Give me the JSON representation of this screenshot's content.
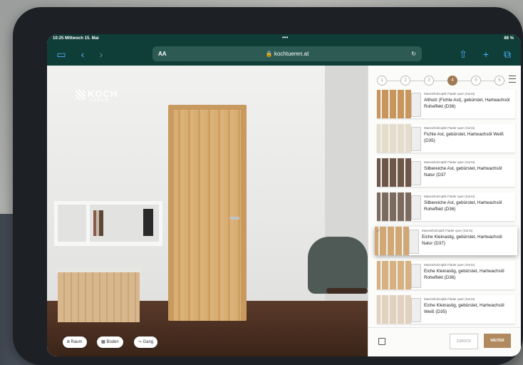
{
  "status": {
    "time": "10:25 Mittwoch 15. Mai",
    "battery": "88 %"
  },
  "browser": {
    "aa": "AA",
    "url": "kochtueren.at"
  },
  "logo": {
    "name": "KOCH",
    "sub": "TÜREN"
  },
  "room_buttons": [
    "Raum",
    "Boden",
    "Gang"
  ],
  "steps": [
    "1",
    "2",
    "3",
    "4",
    "5",
    "6"
  ],
  "active_step": 4,
  "options": [
    {
      "category": "Massivholzoptik Flader quer (Sorra)",
      "title": "Altholz (Fichte Ast), gebürstet, Hartwachsöl Roheffekt (D36)",
      "color": "#c8955a"
    },
    {
      "category": "Massivholzoptik Flader quer (Sorra)",
      "title": "Fichte Ast, gebürstet, Hartwachsöl Weiß (D35)",
      "color": "#e6dccb"
    },
    {
      "category": "Massivholzoptik Flader quer (Sorra)",
      "title": "Silbereiche Ast, gebürstet, Hartwachsöl Natur (D37",
      "color": "#6e5648"
    },
    {
      "category": "Massivholzoptik Flader quer (Sorra)",
      "title": "Silbereiche Ast, gebürstet, Hartwachsöl Roheffekt (D36)",
      "color": "#7d6a5f"
    },
    {
      "category": "Massivholzoptik Flader quer (Sorra)",
      "title": "Eiche Kleinastig, gebürstet, Hartwachsöl Natur (D37)",
      "color": "#d1a774",
      "selected": true
    },
    {
      "category": "Massivholzoptik Flader quer (Sorra)",
      "title": "Eiche Kleinastig, gebürstet, Hartwachsöl Roheffekt (D36)",
      "color": "#d7b17f"
    },
    {
      "category": "Massivholzoptik Flader quer (Sorra)",
      "title": "Eiche Kleinastig, gebürstet, Hartwachsöl Weiß (D35)",
      "color": "#e2d2bd"
    }
  ],
  "footer": {
    "back": "ZURÜCK",
    "next": "WEITER"
  }
}
